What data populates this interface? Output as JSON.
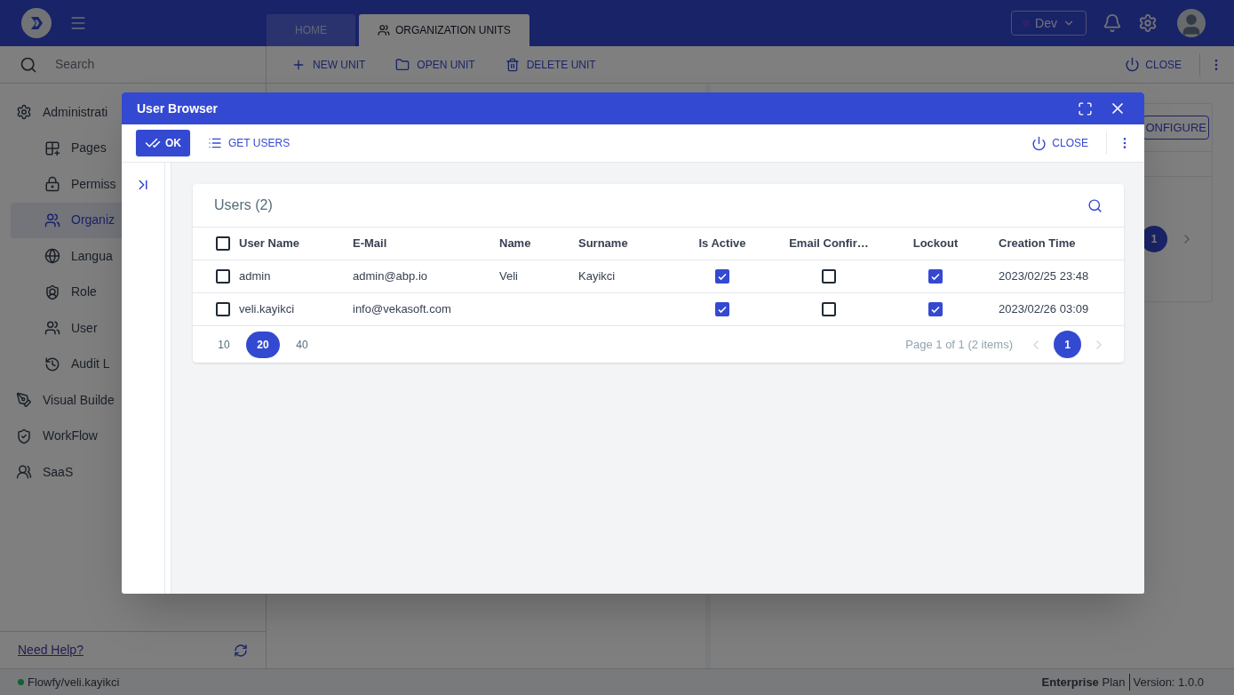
{
  "header": {
    "environment": "Dev"
  },
  "tabs": [
    {
      "label": "HOME",
      "selected": false
    },
    {
      "label": "ORGANIZATION UNITS",
      "selected": true
    }
  ],
  "sidebar": {
    "search_placeholder": "Search",
    "items": [
      {
        "label": "Administrati",
        "selected": false,
        "children": [
          {
            "label": "Pages",
            "selected": false
          },
          {
            "label": "Permiss",
            "selected": false
          },
          {
            "label": "Organiz",
            "selected": true
          },
          {
            "label": "Langua",
            "selected": false
          },
          {
            "label": "Role",
            "selected": false
          },
          {
            "label": "User",
            "selected": false
          },
          {
            "label": "Audit L",
            "selected": false
          }
        ]
      },
      {
        "label": "Visual Builde",
        "selected": false
      },
      {
        "label": "WorkFlow",
        "selected": false
      },
      {
        "label": "SaaS",
        "selected": false
      }
    ],
    "help_link": "Need Help?"
  },
  "toolbar": {
    "buttons": [
      "NEW UNIT",
      "OPEN UNIT",
      "DELETE UNIT"
    ],
    "close": "CLOSE"
  },
  "background_panel": {
    "button": "ONFIGURE",
    "page": "1"
  },
  "dialog": {
    "title": "User Browser",
    "ok": "OK",
    "get_users": "GET USERS",
    "close": "CLOSE",
    "card_title": "Users (2)",
    "all_checked": false,
    "columns": [
      "User Name",
      "E-Mail",
      "Name",
      "Surname",
      "Is Active",
      "Email Confir…",
      "Lockout",
      "Creation Time"
    ],
    "rows": [
      {
        "checked": false,
        "user_name": "admin",
        "email": "admin@abp.io",
        "name": "Veli",
        "surname": "Kayikci",
        "is_active": true,
        "email_confirmed": false,
        "lockout": true,
        "creation_time": "2023/02/25 23:48"
      },
      {
        "checked": false,
        "user_name": "veli.kayikci",
        "email": "info@vekasoft.com",
        "is_active": true,
        "email_confirmed": false,
        "lockout": true,
        "creation_time": "2023/02/26 03:09"
      }
    ],
    "page_sizes": [
      {
        "label": "10",
        "selected": false
      },
      {
        "label": "20",
        "selected": true
      },
      {
        "label": "40",
        "selected": false
      }
    ],
    "page_info": "Page 1 of 1 (2 items)",
    "pages": [
      {
        "label": "1",
        "selected": true
      }
    ]
  },
  "status_bar": {
    "user": "Flowfy/veli.kayikci",
    "plan": "**Enterprise** Plan",
    "version": "Version: 1.0.0"
  }
}
